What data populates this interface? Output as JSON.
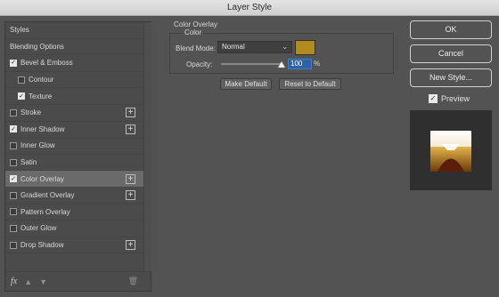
{
  "window": {
    "title": "Layer Style"
  },
  "styles_panel": {
    "items": [
      {
        "label": "Styles",
        "checkbox": null,
        "checked": false,
        "sub": false,
        "plus": false,
        "active": false
      },
      {
        "label": "Blending Options",
        "checkbox": null,
        "checked": false,
        "sub": false,
        "plus": false,
        "active": false
      },
      {
        "label": "Bevel & Emboss",
        "checkbox": true,
        "checked": true,
        "sub": false,
        "plus": false,
        "active": false
      },
      {
        "label": "Contour",
        "checkbox": true,
        "checked": false,
        "sub": true,
        "plus": false,
        "active": false
      },
      {
        "label": "Texture",
        "checkbox": true,
        "checked": true,
        "sub": true,
        "plus": false,
        "active": false
      },
      {
        "label": "Stroke",
        "checkbox": true,
        "checked": false,
        "sub": false,
        "plus": true,
        "active": false
      },
      {
        "label": "Inner Shadow",
        "checkbox": true,
        "checked": true,
        "sub": false,
        "plus": true,
        "active": false
      },
      {
        "label": "Inner Glow",
        "checkbox": true,
        "checked": false,
        "sub": false,
        "plus": false,
        "active": false
      },
      {
        "label": "Satin",
        "checkbox": true,
        "checked": false,
        "sub": false,
        "plus": false,
        "active": false
      },
      {
        "label": "Color Overlay",
        "checkbox": true,
        "checked": true,
        "sub": false,
        "plus": true,
        "active": true
      },
      {
        "label": "Gradient Overlay",
        "checkbox": true,
        "checked": false,
        "sub": false,
        "plus": true,
        "active": false
      },
      {
        "label": "Pattern Overlay",
        "checkbox": true,
        "checked": false,
        "sub": false,
        "plus": false,
        "active": false
      },
      {
        "label": "Outer Glow",
        "checkbox": true,
        "checked": false,
        "sub": false,
        "plus": false,
        "active": false
      },
      {
        "label": "Drop Shadow",
        "checkbox": true,
        "checked": false,
        "sub": false,
        "plus": true,
        "active": false
      }
    ],
    "footer_icons": [
      "fx-icon",
      "arrow-up-icon",
      "arrow-down-icon",
      "trash-icon"
    ]
  },
  "color_overlay": {
    "title": "Color Overlay",
    "group_label": "Color",
    "blend_mode_label": "Blend Mode:",
    "blend_mode_value": "Normal",
    "swatch_color": "#b28b1f",
    "opacity_label": "Opacity:",
    "opacity_value": "100",
    "opacity_unit": "%",
    "opacity_fraction": 1.0,
    "make_default_label": "Make Default",
    "reset_default_label": "Reset to Default"
  },
  "actions": {
    "ok_label": "OK",
    "cancel_label": "Cancel",
    "new_style_label": "New Style...",
    "preview_label": "Preview",
    "preview_checked": true
  }
}
